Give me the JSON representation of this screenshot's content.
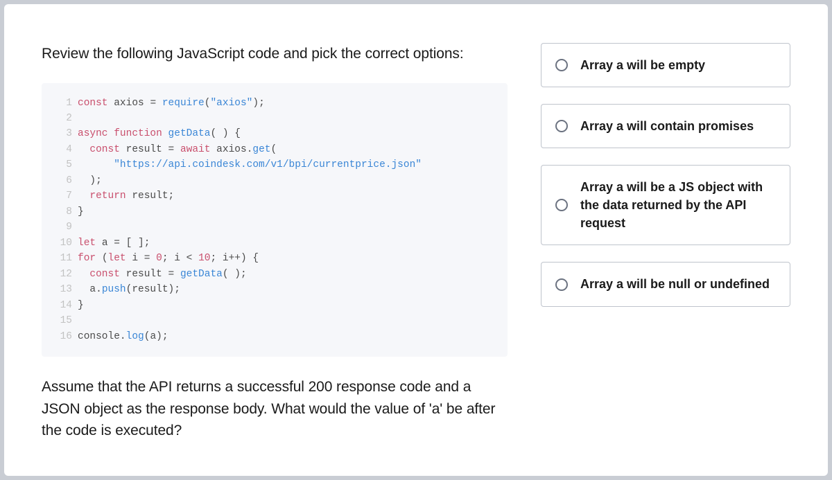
{
  "question_intro": "Review the following JavaScript code and pick the correct options:",
  "question_followup": "Assume that the API returns a successful 200 response code and a JSON object as the response body. What would the value of 'a' be after the code is executed?",
  "code": {
    "lines": [
      "const axios = require(\"axios\");",
      "",
      "async function getData() {",
      "  const result = await axios.get(",
      "      \"https://api.coindesk.com/v1/bpi/currentprice.json\"",
      "  );",
      "  return result;",
      "}",
      "",
      "let a = [];",
      "for (let i = 0; i < 10; i++) {",
      "  const result = getData();",
      "  a.push(result);",
      "}",
      "",
      "console.log(a);"
    ]
  },
  "options": [
    {
      "label": "Array a will be empty"
    },
    {
      "label": "Array a will contain promises"
    },
    {
      "label": "Array a will be a JS object with the data returned by the API request"
    },
    {
      "label": "Array a will be null or undefined"
    }
  ]
}
